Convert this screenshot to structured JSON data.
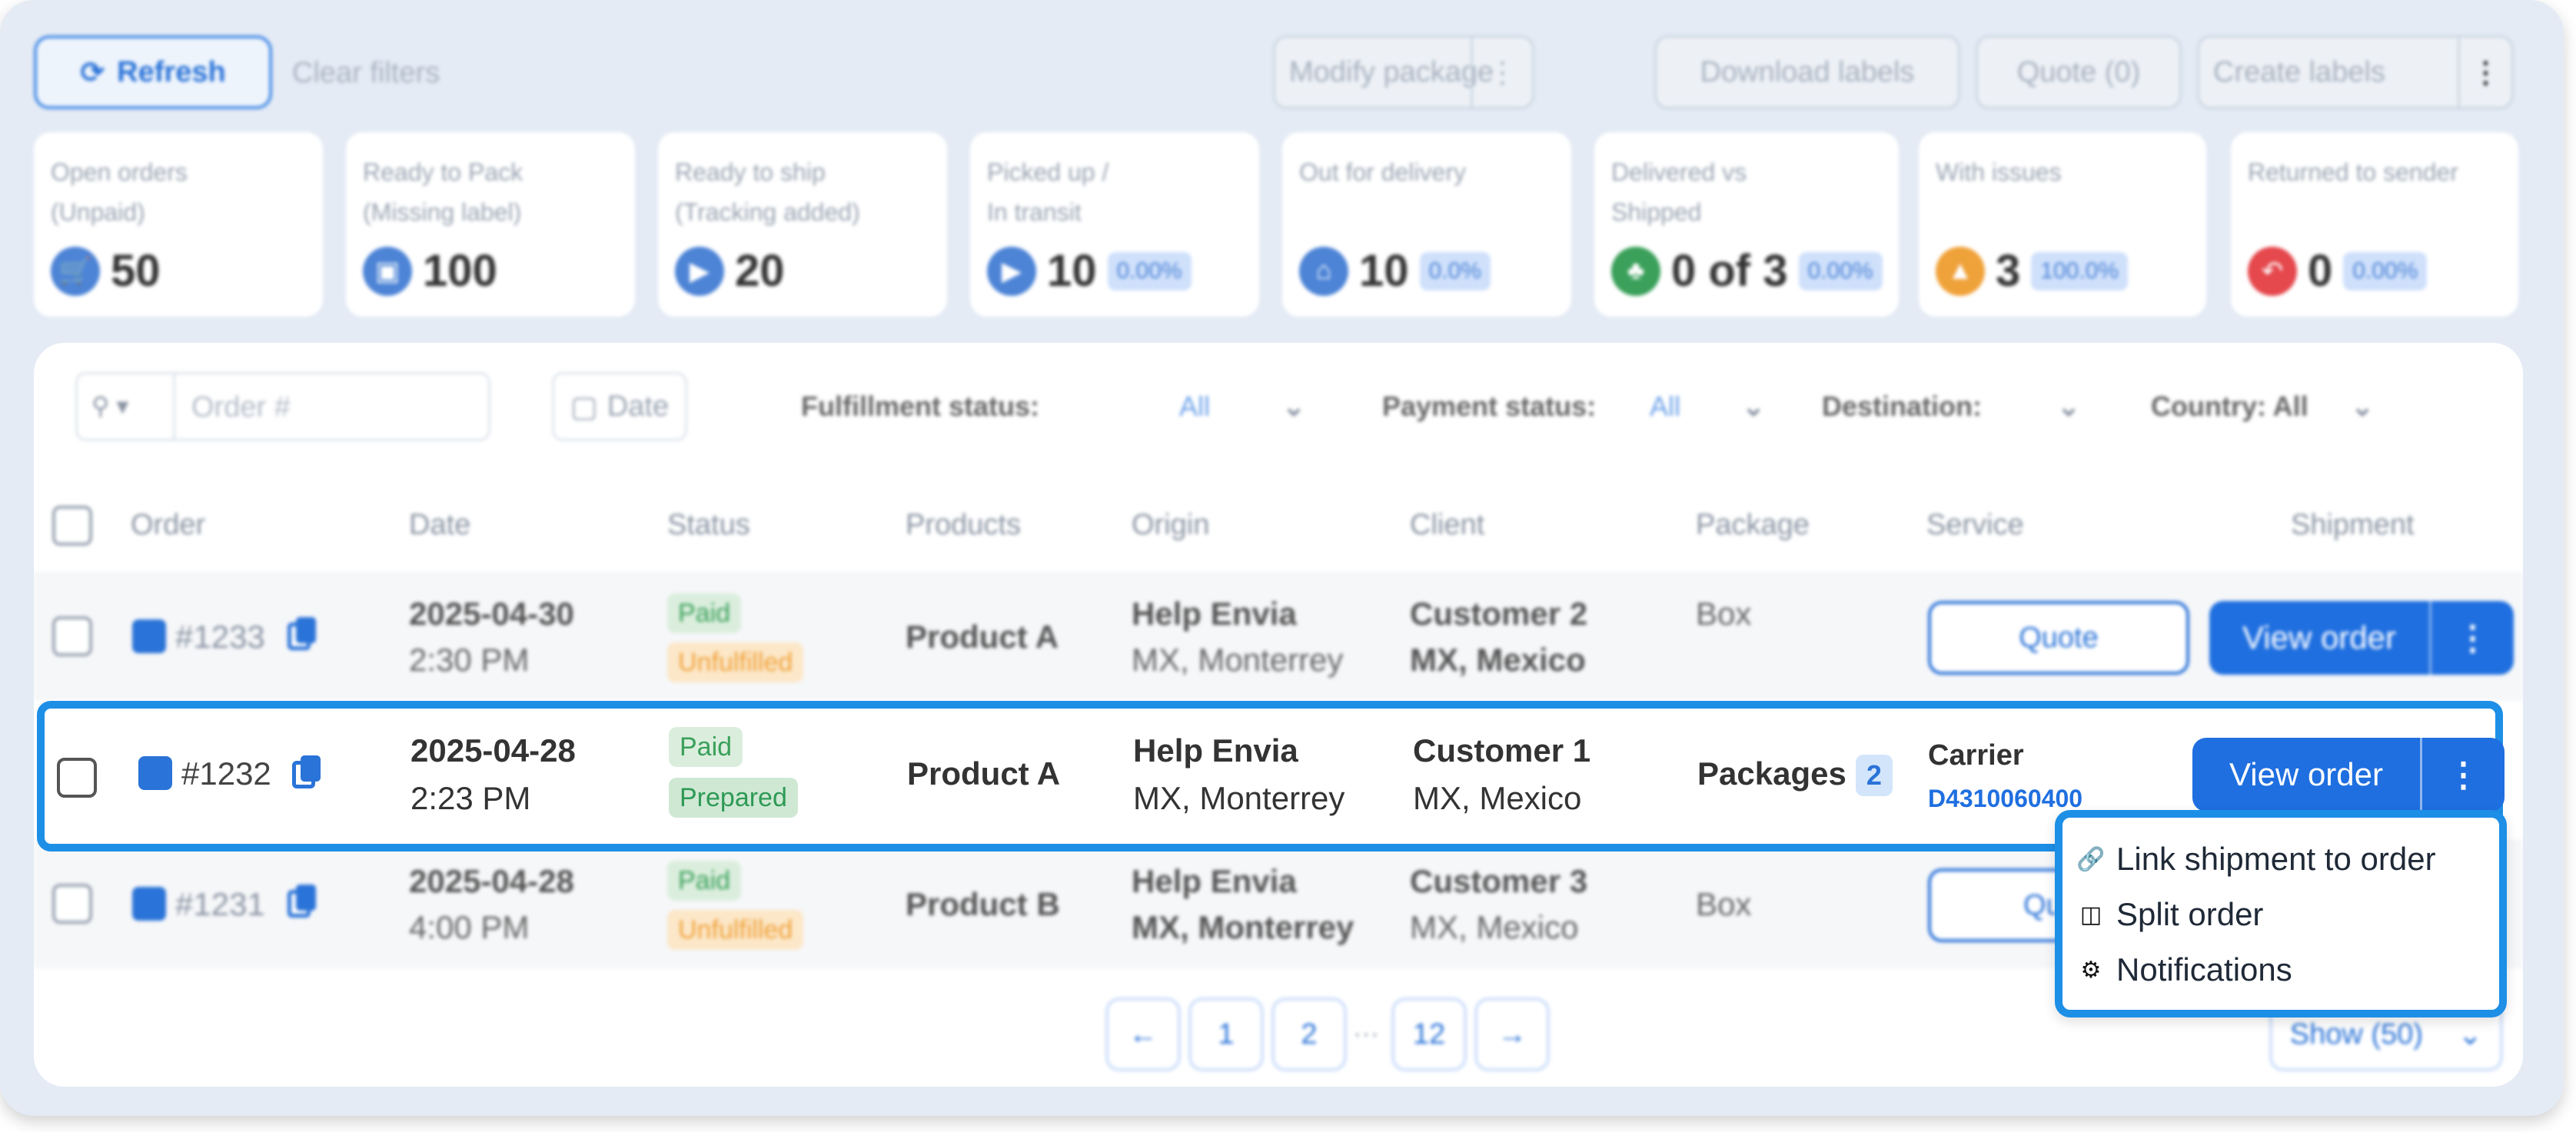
{
  "toolbar": {
    "refresh_label": "Refresh",
    "clear_filters_label": "Clear filters",
    "modify_package_label": "Modify package",
    "download_labels_label": "Download labels",
    "quote_label": "Quote (0)",
    "create_labels_label": "Create labels"
  },
  "kpis": [
    {
      "label_line1": "Open orders",
      "label_line2": "(Unpaid)",
      "value": "50",
      "pct": "",
      "icon": "cart-icon",
      "color": "#4d84d6"
    },
    {
      "label_line1": "Ready to Pack",
      "label_line2": "(Missing label)",
      "value": "100",
      "pct": "",
      "icon": "box-icon",
      "color": "#4d84d6"
    },
    {
      "label_line1": "Ready to ship",
      "label_line2": "(Tracking added)",
      "value": "20",
      "pct": "",
      "icon": "truck-icon",
      "color": "#4d84d6"
    },
    {
      "label_line1": "Picked up /",
      "label_line2": "In transit",
      "value": "10",
      "pct": "0.00%",
      "icon": "truck-icon",
      "color": "#4d84d6"
    },
    {
      "label_line1": "Out for delivery",
      "label_line2": "",
      "value": "10",
      "pct": "0.0%",
      "icon": "home-icon",
      "color": "#4d84d6"
    },
    {
      "label_line1": "Delivered vs",
      "label_line2": "Shipped",
      "value": "0 of 3",
      "pct": "0.00%",
      "icon": "people-icon",
      "color": "#3aa05a"
    },
    {
      "label_line1": "With issues",
      "label_line2": "",
      "value": "3",
      "pct": "100.0%",
      "icon": "warning-icon",
      "color": "#f0a23a"
    },
    {
      "label_line1": "Returned to sender",
      "label_line2": "",
      "value": "0",
      "pct": "0.00%",
      "icon": "return-icon",
      "color": "#e5484d"
    }
  ],
  "filters": {
    "search_placeholder": "Order #",
    "date_label": "Date",
    "fulfillment_label": "Fulfillment status:",
    "fulfillment_value": "All",
    "payment_label": "Payment status:",
    "payment_value": "All",
    "destination_label": "Destination:",
    "country_label": "Country: All"
  },
  "columns": [
    "Order",
    "Date",
    "Status",
    "Products",
    "Origin",
    "Client",
    "Package",
    "Service",
    "Shipment"
  ],
  "rows": [
    {
      "order": "#1233",
      "date": "2025-04-30",
      "time": "2:30 PM",
      "status1": "Paid",
      "status2": "Unfulfilled",
      "product": "Product A",
      "origin_name": "Help Envia",
      "origin_loc": "MX, Monterrey",
      "client_name": "Customer 2",
      "client_loc": "MX, Mexico",
      "package": "Box",
      "service_button": "Quote",
      "shipment_button": "View order"
    },
    {
      "order": "#1232",
      "date": "2025-04-28",
      "time": "2:23 PM",
      "status1": "Paid",
      "status2": "Prepared",
      "product": "Product A",
      "origin_name": "Help Envia",
      "origin_loc": "MX, Monterrey",
      "client_name": "Customer 1",
      "client_loc": "MX, Mexico",
      "package": "Packages",
      "package_count": "2",
      "carrier": "Carrier",
      "tracking": "D4310060400",
      "shipment_button": "View order"
    },
    {
      "order": "#1231",
      "date": "2025-04-28",
      "time": "4:00 PM",
      "status1": "Paid",
      "status2": "Unfulfilled",
      "product": "Product B",
      "origin_name": "Help Envia",
      "origin_loc": "MX, Monterrey",
      "client_name": "Customer 3",
      "client_loc": "MX, Mexico",
      "package": "Box",
      "service_button": "Quo"
    }
  ],
  "menu": {
    "items": [
      {
        "label": "Link shipment to order",
        "icon": "link-icon"
      },
      {
        "label": "Split order",
        "icon": "split-icon"
      },
      {
        "label": "Notifications",
        "icon": "gear-icon"
      }
    ]
  },
  "pagination": {
    "prev": "←",
    "pages": [
      "1",
      "2"
    ],
    "ellipsis": "···",
    "last": "12",
    "next": "→",
    "show_label": "Show (50)"
  },
  "colors": {
    "accent": "#1f6fe0",
    "focus_border": "#1d8fe6",
    "background": "#e4ebf5"
  }
}
